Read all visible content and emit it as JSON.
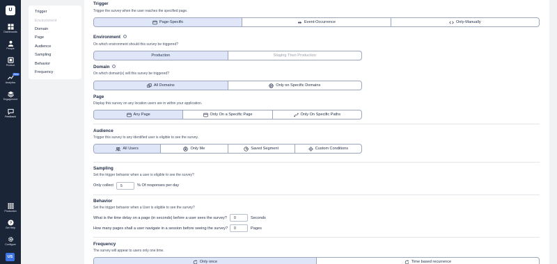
{
  "app": {
    "logo_text": "U",
    "avatar_initials": "US"
  },
  "leftnav": {
    "top": [
      {
        "label": "Dashboards",
        "icon": "dashboard-icon"
      },
      {
        "label": "People",
        "icon": "people-icon"
      },
      {
        "label": "Product",
        "icon": "product-icon"
      },
      {
        "label": "Analytics",
        "icon": "analytics-icon",
        "badge": "New"
      },
      {
        "label": "Engagement",
        "icon": "engagement-icon"
      },
      {
        "label": "Feedback",
        "icon": "feedback-icon"
      }
    ],
    "bottom": [
      {
        "label": "Production",
        "icon": "grid-icon"
      },
      {
        "label": "Get Help",
        "icon": "help-icon"
      },
      {
        "label": "Configure",
        "icon": "gear-icon"
      }
    ]
  },
  "subnav": {
    "items": [
      "Trigger",
      "Environment",
      "Domain",
      "Page",
      "Audience",
      "Sampling",
      "Behavior",
      "Frequency"
    ]
  },
  "trigger": {
    "title": "Trigger",
    "desc": "Trigger the survey when the user reaches the specified page.",
    "options": [
      "Page-Specific",
      "Event-Occurrence",
      "Only-Manually"
    ]
  },
  "environment": {
    "title": "Environment",
    "desc": "On which environment should this survey be triggered?",
    "options": [
      "Production",
      "Staging Then Production"
    ]
  },
  "domain": {
    "title": "Domain",
    "desc": "On which domain(s) will this survey be triggered?",
    "options": [
      "All Domains",
      "Only on Specific Domains"
    ]
  },
  "page": {
    "title": "Page",
    "desc": "Display this survey on any location users are in within your application.",
    "options": [
      "Any Page",
      "Only On a Specific Page",
      "Only On Specific Paths"
    ]
  },
  "audience": {
    "title": "Audience",
    "desc": "Trigger this survey to any identified user is eligible to see the survey.",
    "options": [
      "All Users",
      "Only Me",
      "Saved Segment",
      "Custom Conditions"
    ]
  },
  "sampling": {
    "title": "Sampling",
    "desc": "Set the trigger behavior when a user is eligible to see the survey?",
    "label": "Only collect",
    "value": "5",
    "suffix": "% Of responses per day"
  },
  "behavior": {
    "title": "Behavior",
    "desc": "Set the trigger behavior when a User is eligible to see the survey?",
    "q1": "What is the time delay on a page (in seconds) before a user sees the survey?",
    "q1_value": "0",
    "q1_unit": "Seconds",
    "q2": "How many pages shall a user navigate in a session before seeing the survey?",
    "q2_value": "0",
    "q2_unit": "Pages"
  },
  "frequency": {
    "title": "Frequency",
    "desc": "The survey will appear to users only one time.",
    "options": [
      "Only once",
      "Time based recurrence"
    ]
  }
}
